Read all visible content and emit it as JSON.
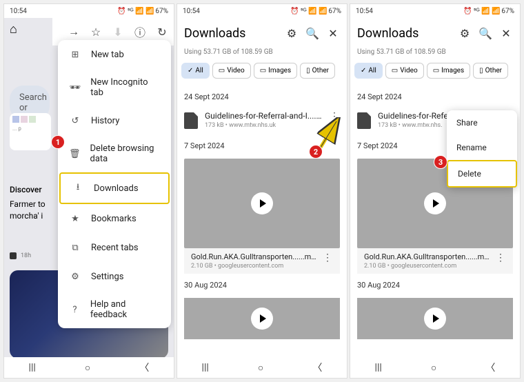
{
  "status": {
    "time": "10:54",
    "battery": "67%",
    "icons": "⏰ ⁵ᴳ 📶 📶"
  },
  "panel1": {
    "search": "Search or",
    "menu": [
      {
        "icon": "plus",
        "label": "New tab"
      },
      {
        "icon": "incognito",
        "label": "New Incognito tab"
      },
      {
        "icon": "history",
        "label": "History"
      },
      {
        "icon": "trash",
        "label": "Delete browsing data"
      },
      {
        "icon": "download",
        "label": "Downloads",
        "hl": true
      },
      {
        "icon": "star",
        "label": "Bookmarks"
      },
      {
        "icon": "tabs",
        "label": "Recent tabs"
      },
      {
        "icon": "gear",
        "label": "Settings"
      },
      {
        "icon": "help",
        "label": "Help and feedback"
      }
    ],
    "discover": "Discover",
    "news": "Farmer to morcha' i",
    "meta_time": "18h"
  },
  "downloads": {
    "title": "Downloads",
    "storage": "Using 53.71 GB of 108.59 GB",
    "chips": [
      {
        "label": "All",
        "active": true,
        "icon": "✓"
      },
      {
        "label": "Video",
        "icon": "▭"
      },
      {
        "label": "Images",
        "icon": "▭"
      },
      {
        "label": "Other",
        "icon": "▭"
      }
    ],
    "date1": "24 Sept 2024",
    "file1": {
      "name": "Guidelines-for-Referral-and-I.....pdf",
      "meta": "173 kB • www.mtw.nhs.uk"
    },
    "file1b": {
      "name": "Guidelines-for-Refe",
      "meta": "173 kB • www.mtw.nhs."
    },
    "date2": "7 Sept 2024",
    "video1": {
      "name": "Gold.Run.AKA.Gulltransporten......mkv",
      "meta": "2.10 GB • googleusercontent.com"
    },
    "date3": "30 Aug 2024"
  },
  "context": [
    {
      "label": "Share"
    },
    {
      "label": "Rename"
    },
    {
      "label": "Delete",
      "hl": true
    }
  ]
}
